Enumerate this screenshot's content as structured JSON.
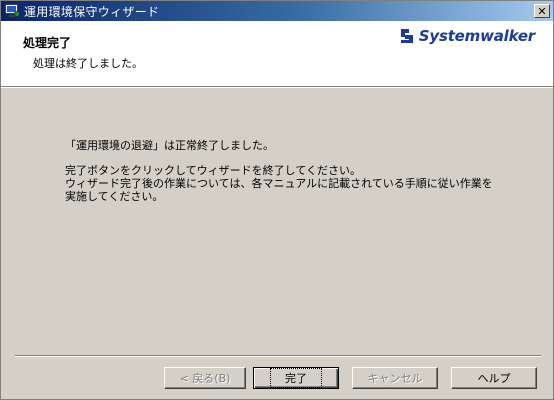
{
  "window": {
    "title": "運用環境保守ウィザード",
    "close_label": "✕"
  },
  "header": {
    "title": "処理完了",
    "subtitle": "処理は終了しました。",
    "logo_text": "Systemwalker"
  },
  "content": {
    "line1": "「運用環境の退避」は正常終了しました。",
    "line2": "完了ボタンをクリックしてウィザードを終了してください。",
    "line3": "ウィザード完了後の作業については、各マニュアルに記載されている手順に従い作業を",
    "line4": "実施してください。"
  },
  "buttons": {
    "back": "< 戻る(B)",
    "finish": "完了",
    "cancel": "キャンセル",
    "help": "ヘルプ"
  },
  "colors": {
    "titlebar_start": "#0a246a",
    "titlebar_end": "#a6caf0",
    "logo": "#1a3c9c",
    "face": "#d4d0c8"
  }
}
